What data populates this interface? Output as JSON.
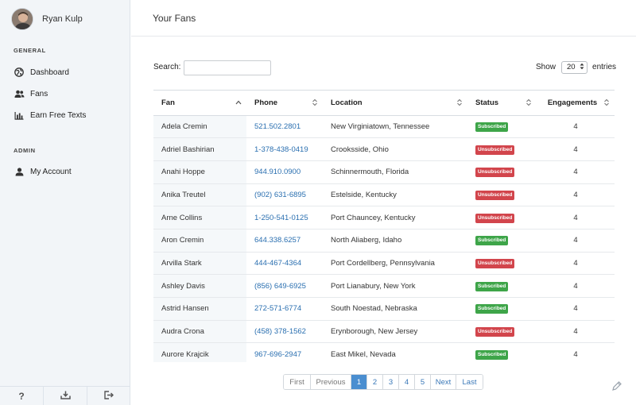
{
  "sidebar": {
    "user_name": "Ryan Kulp",
    "general_label": "GENERAL",
    "admin_label": "ADMIN",
    "items": [
      {
        "label": "Dashboard",
        "icon": "globe-icon"
      },
      {
        "label": "Fans",
        "icon": "users-icon"
      },
      {
        "label": "Earn Free Texts",
        "icon": "bar-chart-icon"
      },
      {
        "label": "My Account",
        "icon": "user-icon"
      }
    ],
    "footer": [
      {
        "icon": "help-icon",
        "glyph": "?"
      },
      {
        "icon": "download-icon"
      },
      {
        "icon": "logout-icon"
      }
    ]
  },
  "header": {
    "title": "Your Fans"
  },
  "controls": {
    "search_label": "Search:",
    "search_value": "",
    "show_label": "Show",
    "entries_value": "20",
    "entries_label": "entries"
  },
  "table": {
    "columns": [
      "Fan",
      "Phone",
      "Location",
      "Status",
      "Engagements"
    ],
    "rows": [
      {
        "fan": "Adela Cremin",
        "phone": "521.502.2801",
        "location": "New Virginiatown, Tennessee",
        "status": "Subscribed",
        "engagements": "4"
      },
      {
        "fan": "Adriel Bashirian",
        "phone": "1-378-438-0419",
        "location": "Crooksside, Ohio",
        "status": "Unsubscribed",
        "engagements": "4"
      },
      {
        "fan": "Anahi Hoppe",
        "phone": "944.910.0900",
        "location": "Schinnermouth, Florida",
        "status": "Unsubscribed",
        "engagements": "4"
      },
      {
        "fan": "Anika Treutel",
        "phone": "(902) 631-6895",
        "location": "Estelside, Kentucky",
        "status": "Unsubscribed",
        "engagements": "4"
      },
      {
        "fan": "Arne Collins",
        "phone": "1-250-541-0125",
        "location": "Port Chauncey, Kentucky",
        "status": "Unsubscribed",
        "engagements": "4"
      },
      {
        "fan": "Aron Cremin",
        "phone": "644.338.6257",
        "location": "North Aliaberg, Idaho",
        "status": "Subscribed",
        "engagements": "4"
      },
      {
        "fan": "Arvilla Stark",
        "phone": "444-467-4364",
        "location": "Port Cordellberg, Pennsylvania",
        "status": "Unsubscribed",
        "engagements": "4"
      },
      {
        "fan": "Ashley Davis",
        "phone": "(856) 649-6925",
        "location": "Port Lianabury, New York",
        "status": "Subscribed",
        "engagements": "4"
      },
      {
        "fan": "Astrid Hansen",
        "phone": "272-571-6774",
        "location": "South Noestad, Nebraska",
        "status": "Subscribed",
        "engagements": "4"
      },
      {
        "fan": "Audra Crona",
        "phone": "(458) 378-1562",
        "location": "Erynborough, New Jersey",
        "status": "Unsubscribed",
        "engagements": "4"
      },
      {
        "fan": "Aurore Krajcik",
        "phone": "967-696-2947",
        "location": "East Mikel, Nevada",
        "status": "Subscribed",
        "engagements": "4"
      }
    ]
  },
  "pagination": {
    "buttons": [
      {
        "label": "First",
        "state": "disabled"
      },
      {
        "label": "Previous",
        "state": "disabled"
      },
      {
        "label": "1",
        "state": "active"
      },
      {
        "label": "2",
        "state": "normal"
      },
      {
        "label": "3",
        "state": "normal"
      },
      {
        "label": "4",
        "state": "normal"
      },
      {
        "label": "5",
        "state": "normal"
      },
      {
        "label": "Next",
        "state": "normal"
      },
      {
        "label": "Last",
        "state": "normal"
      }
    ]
  },
  "colors": {
    "subscribed": "#3ea549",
    "unsubscribed": "#d2454c",
    "link": "#2a6fb0",
    "active_page": "#4a8ed0"
  }
}
